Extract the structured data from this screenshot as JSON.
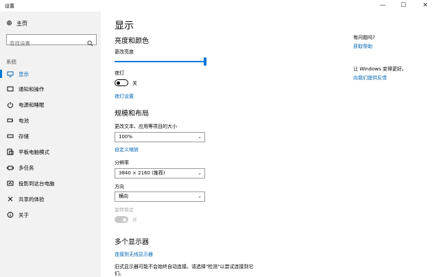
{
  "window": {
    "title": "设置",
    "minimize": "—",
    "maximize": "☐",
    "close": "✕"
  },
  "sidebar": {
    "home": "主页",
    "search_placeholder": "查找设置",
    "section": "系统",
    "items": [
      {
        "label": "显示",
        "icon": "display-icon",
        "active": true
      },
      {
        "label": "通知和操作",
        "icon": "notification-icon"
      },
      {
        "label": "电源和睡眠",
        "icon": "power-icon"
      },
      {
        "label": "电池",
        "icon": "battery-icon"
      },
      {
        "label": "存储",
        "icon": "storage-icon"
      },
      {
        "label": "平板电脑模式",
        "icon": "tablet-icon"
      },
      {
        "label": "多任务",
        "icon": "multitask-icon"
      },
      {
        "label": "投影到这台电脑",
        "icon": "project-icon"
      },
      {
        "label": "共享的体验",
        "icon": "share-icon"
      },
      {
        "label": "关于",
        "icon": "info-icon"
      }
    ]
  },
  "main": {
    "title": "显示",
    "brightness_section": "亮度和颜色",
    "brightness_label": "更改亮度",
    "brightness_value": 1.0,
    "night_light_label": "夜灯",
    "night_light_state": "关",
    "night_light_settings": "夜灯设置",
    "scale_section": "规模和布局",
    "scale_label": "更改文本、应用等项目的大小",
    "scale_value": "100%",
    "custom_scale": "自定义缩放",
    "resolution_label": "分辨率",
    "resolution_value": "3840 × 2160 (推荐)",
    "orientation_label": "方向",
    "orientation_value": "横向",
    "rotation_lock_label": "旋转锁定",
    "rotation_lock_state": "开",
    "multi_section": "多个显示器",
    "wireless_link": "连接到无线显示器",
    "old_display_text_1": "旧式显示器可能不会始终自动连接。请选择\"检测\"以尝试连接到它",
    "old_display_text_2": "们。"
  },
  "right": {
    "question": "有问题吗?",
    "help_link": "获取帮助",
    "improve": "让 Windows 变得更好。",
    "feedback_link": "向我们提供反馈"
  }
}
